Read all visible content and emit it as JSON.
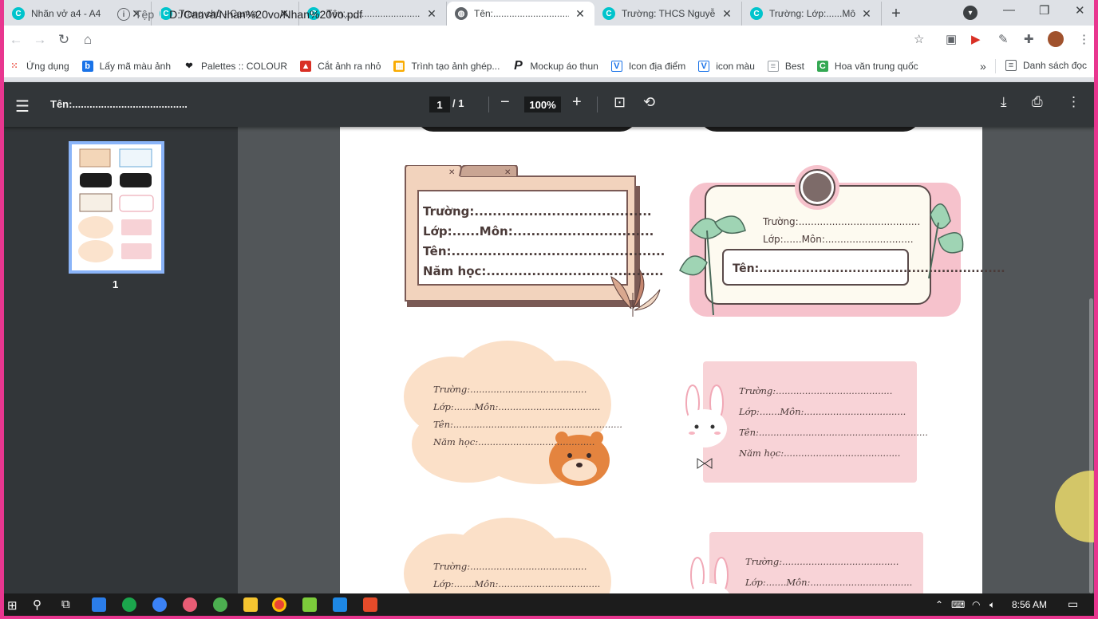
{
  "tabs": [
    {
      "title": "Nhãn vở a4 - A4",
      "icon": "C",
      "active": false
    },
    {
      "title": "Trang chủ - Canva",
      "icon": "C",
      "active": false
    },
    {
      "title": "Tên:........................................",
      "icon": "C",
      "active": false
    },
    {
      "title": "Tên:........................................",
      "icon": "globe",
      "active": true
    },
    {
      "title": "Trường: THCS Nguyễn",
      "icon": "C",
      "active": false
    },
    {
      "title": "Trường: Lớp:......Môn:",
      "icon": "C",
      "active": false
    }
  ],
  "toolbar": {
    "protocol": "Tệp",
    "url": "D:/Canva/Nhan%20vo/Nhan%20vo.pdf"
  },
  "bookmarks": [
    {
      "label": "Ứng dụng",
      "icon": "apps-icon",
      "color": "#ea4335"
    },
    {
      "label": "Lấy mã màu ảnh",
      "icon": "b-icon",
      "color": "#1a73e8"
    },
    {
      "label": "Palettes :: COLOUR",
      "icon": "heart-icon",
      "color": "#202124"
    },
    {
      "label": "Cắt ảnh ra nhỏ",
      "icon": "cut-icon",
      "color": "#d93025"
    },
    {
      "label": "Trình tạo ảnh ghép...",
      "icon": "collage-icon",
      "color": "#f9ab00"
    },
    {
      "label": "Mockup áo thun",
      "icon": "p-icon",
      "color": "#202124"
    },
    {
      "label": "Icon địa điểm",
      "icon": "v-icon",
      "color": "#1a73e8"
    },
    {
      "label": "icon màu",
      "icon": "v-icon",
      "color": "#1a73e8"
    },
    {
      "label": "Best",
      "icon": "doc-icon",
      "color": "#9aa0a6"
    },
    {
      "label": "Hoa văn trung quốc",
      "icon": "c-icon",
      "color": "#34a853"
    }
  ],
  "bookmarks_more": "»",
  "reading_list": "Danh sách đọc",
  "pdf": {
    "title": "Tên:........................................",
    "page_current": "1",
    "page_total": "/ 1",
    "zoom": "100%",
    "thumb_page": "1"
  },
  "labels": {
    "l1": [
      "Trường:.......................................",
      "Lớp:......Môn:...............................",
      "Tên:...............................................",
      "Năm học:.......................................",
      ""
    ],
    "l2": {
      "line1": "Trường:........................................",
      "line2": "Lớp:......Môn:.............................",
      "line3": "Tên:.........................................................."
    },
    "l3": [
      "Trường:........................................",
      "Lớp:.......Môn:...................................",
      "Tên:..........................................................",
      "Năm học:........................................"
    ],
    "l4": [
      "Trường:........................................",
      "Lớp:.......Môn:...................................",
      "Tên:..........................................................",
      "Năm học:........................................"
    ],
    "l5": [
      "Trường:........................................",
      "Lớp:.......Môn:..................................."
    ],
    "l6": [
      "Trường:........................................",
      "Lớp:.......Môn:..................................."
    ]
  },
  "taskbar": {
    "time": "8:56 AM"
  },
  "colors": {
    "accent": "#e8368f",
    "pdf_toolbar": "#323639",
    "viewer_bg": "#525659"
  }
}
